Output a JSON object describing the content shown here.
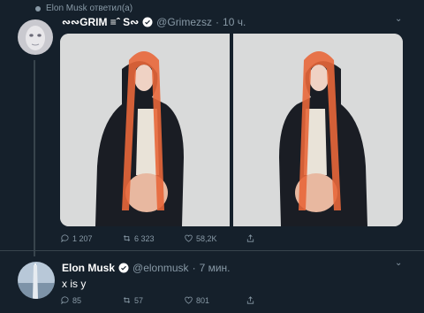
{
  "reply_notice": "Elon Musk ответил(а)",
  "tweet1": {
    "author_name": "∾∾GRIM ≡ˆ S∾",
    "handle": "@Grimezsz",
    "time": "10 ч.",
    "stats": {
      "replies": "1 207",
      "retweets": "6 323",
      "likes": "58,2K"
    }
  },
  "tweet2": {
    "author_name": "Elon Musk",
    "handle": "@elonmusk",
    "time": "7 мин.",
    "text": "x is y",
    "stats": {
      "replies": "85",
      "retweets": "57",
      "likes": "801"
    }
  },
  "colors": {
    "bg": "#15202b",
    "muted": "#8899a6",
    "verified": "#ffffff",
    "divider": "#38444d"
  },
  "icons": [
    "reply-icon",
    "retweet-icon",
    "like-icon",
    "share-icon",
    "verified-icon",
    "chevron-down-icon"
  ]
}
